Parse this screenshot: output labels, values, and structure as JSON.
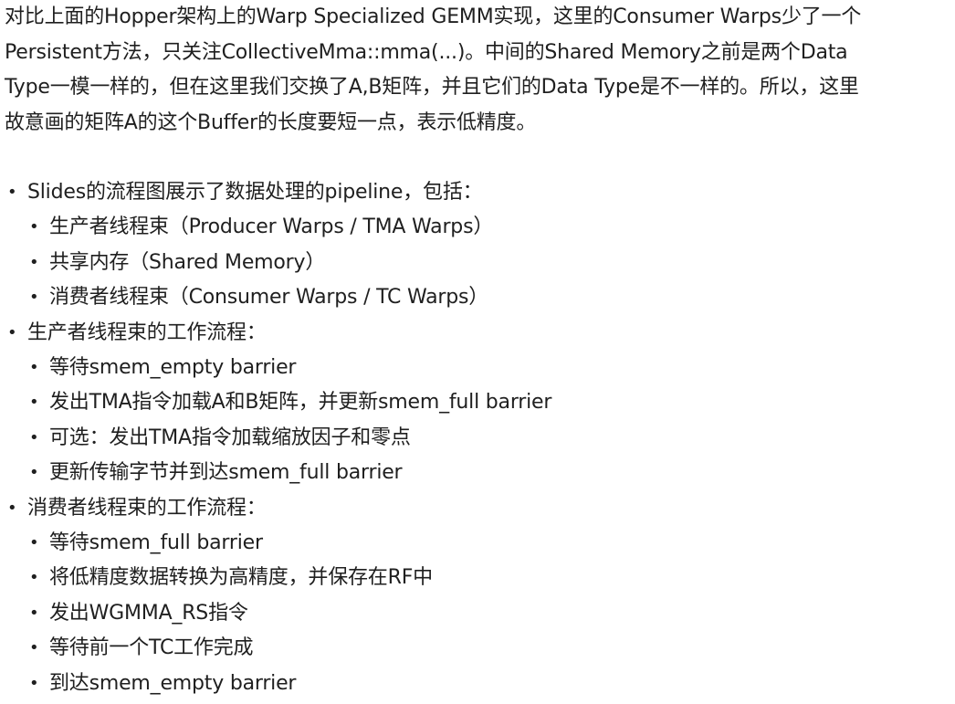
{
  "intro": {
    "lines": [
      "对比上面的Hopper架构上的Warp Specialized GEMM实现，这里的Consumer Warps少了一个",
      "Persistent方法，只关注CollectiveMma::mma(...)。中间的Shared Memory之前是两个Data",
      "Type一模一样的，但在这里我们交换了A,B矩阵，并且它们的Data Type是不一样的。所以，这里",
      "故意画的矩阵A的这个Buffer的长度要短一点，表示低精度。"
    ]
  },
  "sections": [
    {
      "title": "Slides的流程图展示了数据处理的pipeline，包括：",
      "items": [
        "生产者线程束（Producer Warps / TMA Warps）",
        "共享内存（Shared Memory）",
        "消费者线程束（Consumer Warps / TC Warps）"
      ]
    },
    {
      "title": "生产者线程束的工作流程：",
      "items": [
        "等待smem_empty barrier",
        "发出TMA指令加载A和B矩阵，并更新smem_full barrier",
        "可选：发出TMA指令加载缩放因子和零点",
        "更新传输字节并到达smem_full barrier"
      ]
    },
    {
      "title": "消费者线程束的工作流程：",
      "items": [
        "等待smem_full barrier",
        "将低精度数据转换为高精度，并保存在RF中",
        "发出WGMMA_RS指令",
        "等待前一个TC工作完成",
        "到达smem_empty barrier"
      ]
    }
  ],
  "bullet_char": "•"
}
